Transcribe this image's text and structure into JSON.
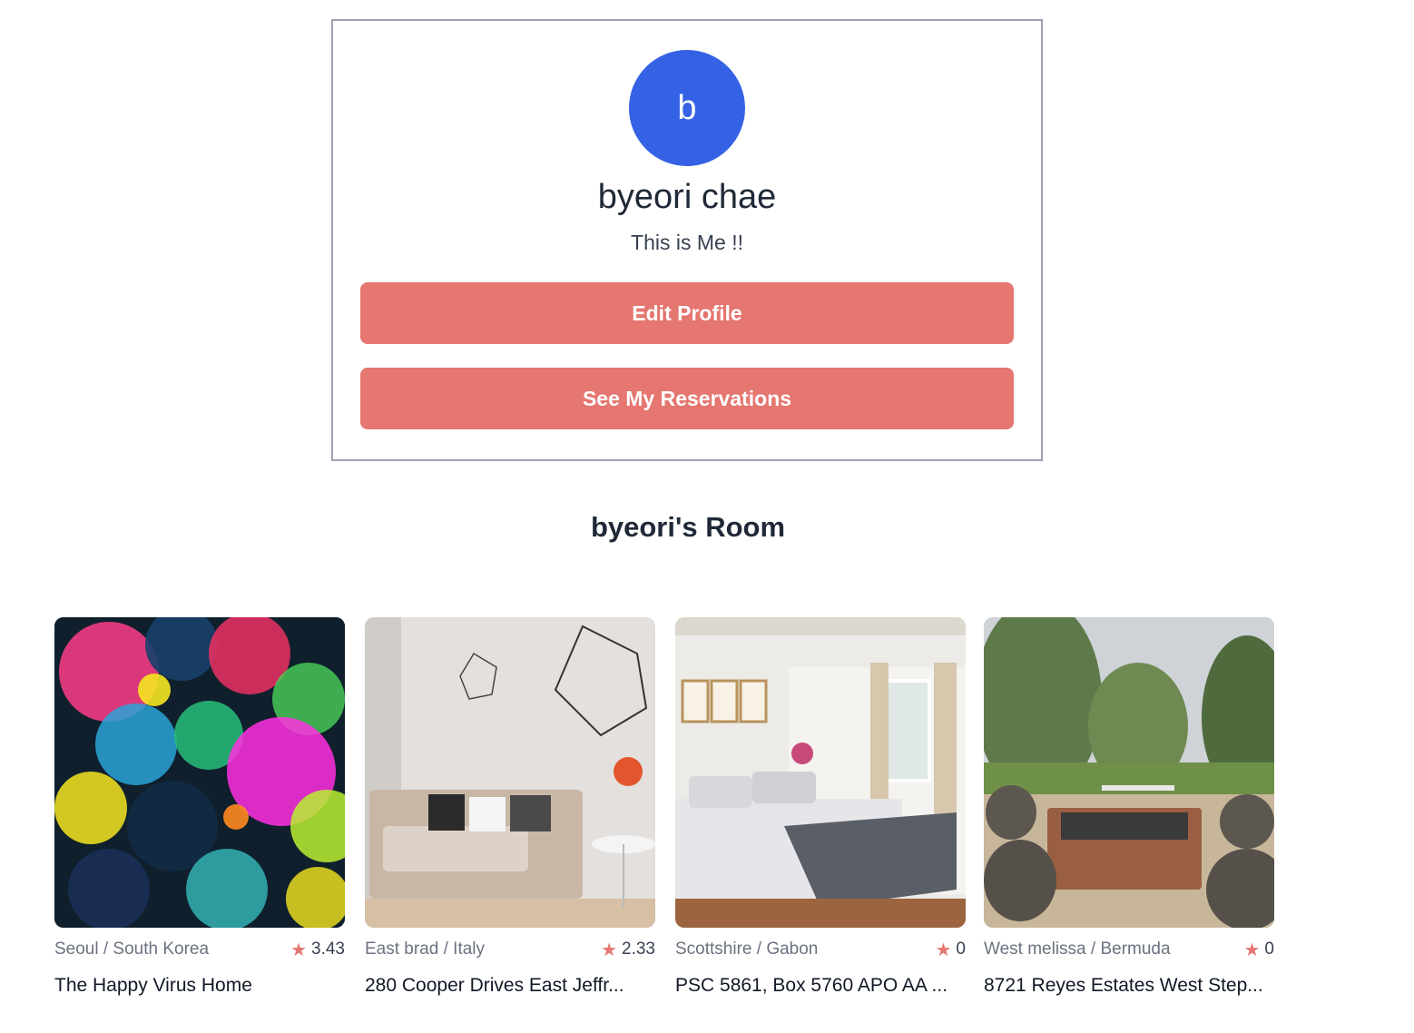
{
  "profile": {
    "avatar_initial": "b",
    "name": "byeori chae",
    "bio": "This is Me !!",
    "edit_label": "Edit Profile",
    "reservations_label": "See My Reservations"
  },
  "rooms_section": {
    "title": "byeori's Room",
    "rooms": [
      {
        "location": "Seoul / South Korea",
        "rating": "3.43",
        "name": "The Happy Virus Home"
      },
      {
        "location": "East brad / Italy",
        "rating": "2.33",
        "name": "280 Cooper Drives East Jeffr..."
      },
      {
        "location": "Scottshire / Gabon",
        "rating": "0",
        "name": "PSC 5861, Box 5760 APO AA ..."
      },
      {
        "location": "West melissa / Bermuda",
        "rating": "0",
        "name": "8721 Reyes Estates West Step..."
      }
    ]
  },
  "colors": {
    "accent": "#e57670",
    "avatar": "#3561e4"
  },
  "icons": {
    "rating": "star-icon"
  }
}
